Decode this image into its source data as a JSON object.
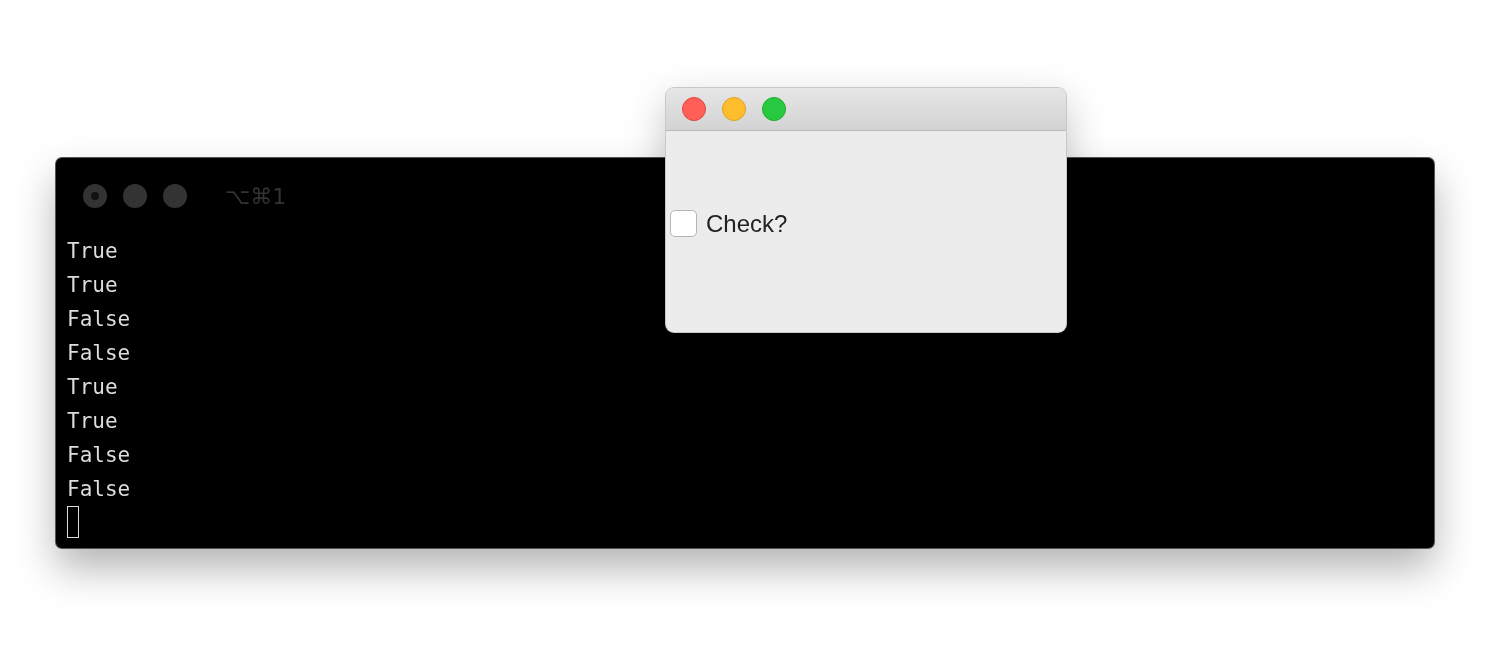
{
  "terminal": {
    "title": "⌥⌘1",
    "lines": [
      "True",
      "True",
      "False",
      "False",
      "True",
      "True",
      "False",
      "False"
    ]
  },
  "dialog": {
    "checkbox": {
      "label": "Check?",
      "checked": false
    }
  }
}
